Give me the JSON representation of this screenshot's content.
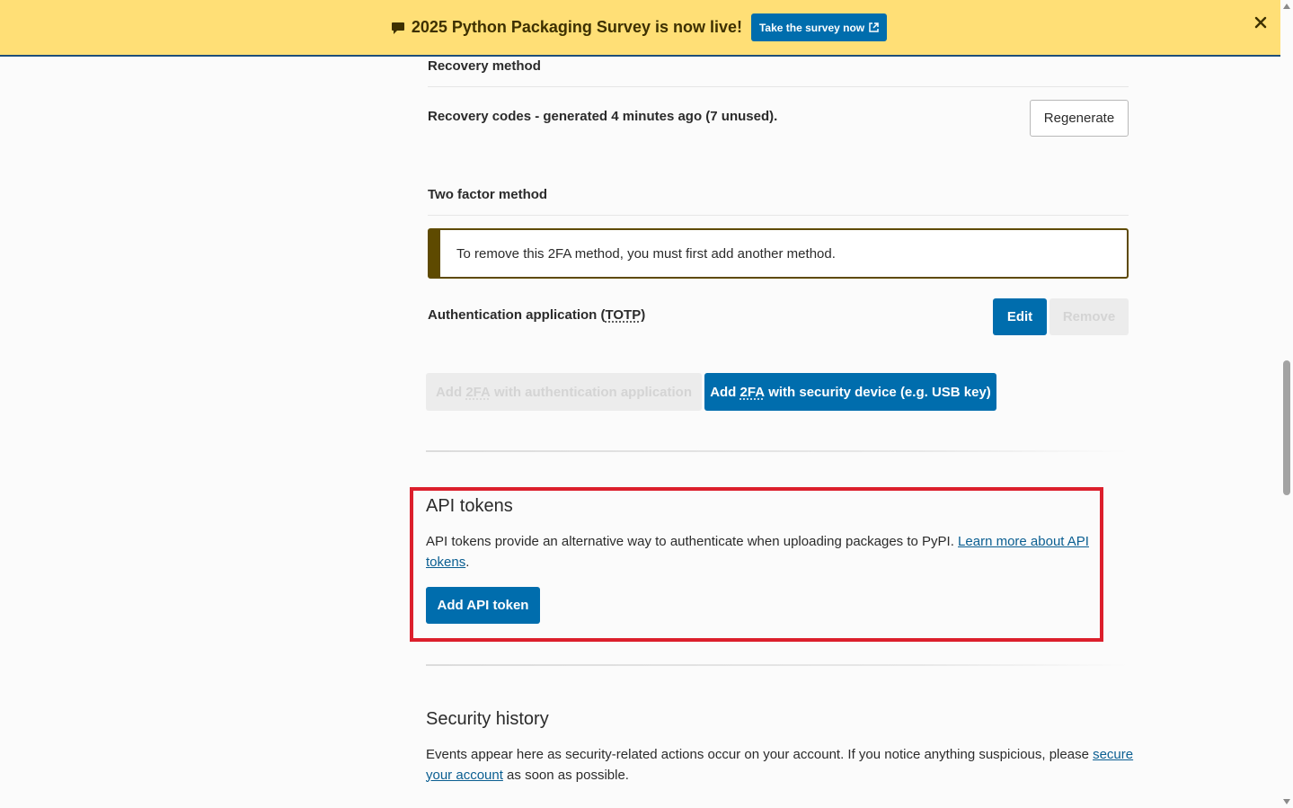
{
  "banner": {
    "icon": "comment-icon",
    "text": "2025 Python Packaging Survey is now live!",
    "cta_label": "Take the survey now",
    "cta_icon": "external-link-icon",
    "close_icon": "close-icon",
    "background": "#ffdf76"
  },
  "recovery": {
    "heading": "Recovery method",
    "codes_prefix": "Recovery codes - generated ",
    "codes_time": "4 minutes ago",
    "codes_suffix": " (7 unused).",
    "regenerate_label": "Regenerate"
  },
  "two_factor": {
    "heading": "Two factor method",
    "callout_text": "To remove this 2FA method, you must first add another method.",
    "auth_app_label": "Authentication application (",
    "auth_app_abbr": "TOTP",
    "auth_app_close": ")",
    "edit_label": "Edit",
    "remove_label": "Remove",
    "add_app_prefix": "Add ",
    "add_app_abbr": "2FA",
    "add_app_suffix": " with authentication application",
    "add_device_prefix": "Add ",
    "add_device_abbr": "2FA",
    "add_device_suffix": " with security device (e.g. USB key)"
  },
  "api_tokens": {
    "heading": "API tokens",
    "description": "API tokens provide an alternative way to authenticate when uploading packages to PyPI. ",
    "link_text_1": "Learn more about API",
    "link_text_2": "tokens",
    "period": ".",
    "add_label": "Add API token"
  },
  "security_history": {
    "heading": "Security history",
    "description": "Events appear here as security-related actions occur on your account. If you notice anything suspicious, please ",
    "link_text_1": "secure",
    "link_text_2": "your account",
    "suffix": " as soon as possible."
  },
  "colors": {
    "primary": "#006dad",
    "warning_border": "#5e4a00",
    "highlight": "#dc1f2c",
    "link": "#0a5e91"
  }
}
